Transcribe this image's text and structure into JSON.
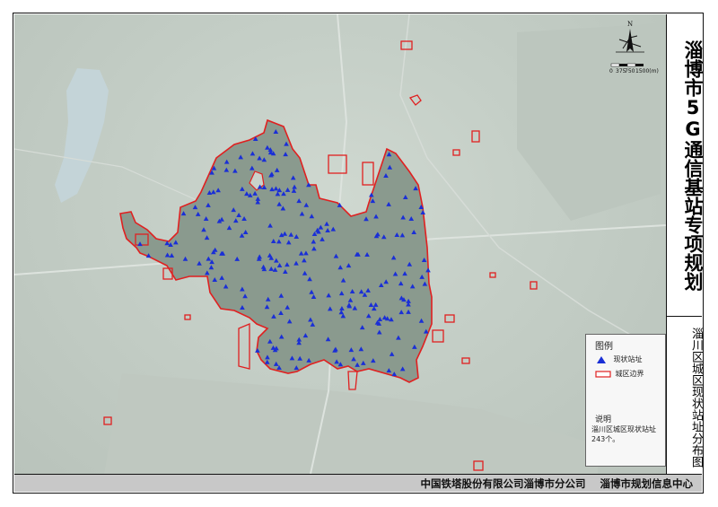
{
  "title": {
    "main": "淄博市5G通信基站专项规划",
    "sub": "淄川区城区现状站址分布图"
  },
  "legend": {
    "title": "图例",
    "items": [
      {
        "label": "现状站址",
        "icon": "blue-triangle-icon",
        "color": "#1a2fd6"
      },
      {
        "label": "城区边界",
        "icon": "red-boundary-icon",
        "color": "#e02020"
      }
    ],
    "description_title": "说明",
    "description": "淄川区城区现状站址243个。"
  },
  "scale": {
    "labels": [
      "0",
      "375",
      "750",
      "1500(m)"
    ]
  },
  "compass": {
    "label": "N"
  },
  "footer": {
    "text": "中国铁塔股份有限公司淄博市分公司    淄博市规划信息中心"
  },
  "colors": {
    "boundary": "#e02020",
    "site": "#1a2fd6",
    "urban": "#8f9e93",
    "base": "#c9d2ca",
    "water": "#c7d8de"
  }
}
